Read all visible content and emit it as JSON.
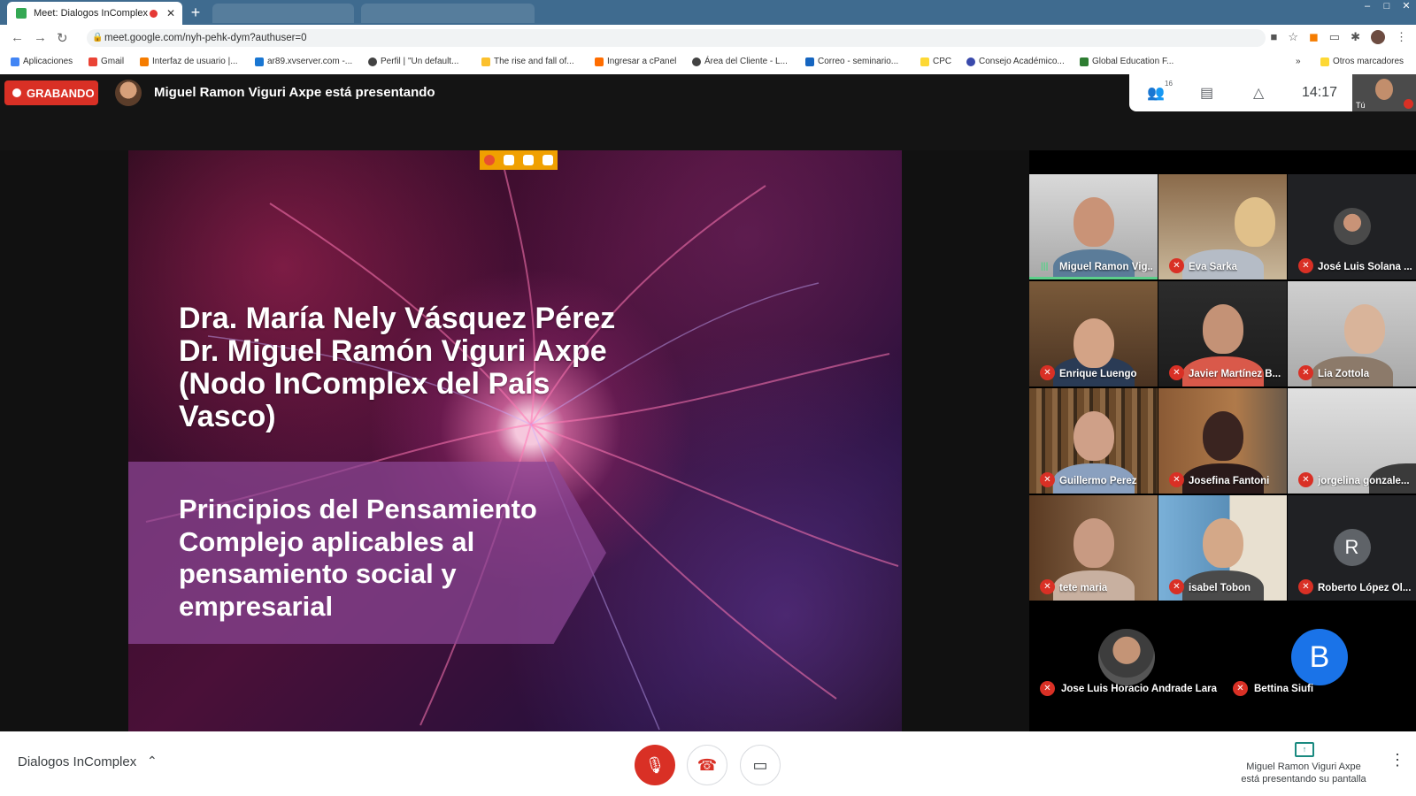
{
  "browser": {
    "tab_title": "Meet: Dialogos InComplex",
    "url": "meet.google.com/nyh-pehk-dym?authuser=0",
    "bookmarks": [
      {
        "label": "Aplicaciones",
        "color": "#4285f4"
      },
      {
        "label": "Gmail",
        "color": "#ea4335"
      },
      {
        "label": "Interfaz de usuario |...",
        "color": "#f57c00"
      },
      {
        "label": "ar89.xvserver.com -...",
        "color": "#1976d2"
      },
      {
        "label": "Perfil | \"Un default...",
        "color": "#424242"
      },
      {
        "label": "The rise and fall of...",
        "color": "#fbc02d"
      },
      {
        "label": "Ingresar a cPanel",
        "color": "#ff6d00"
      },
      {
        "label": "Área del Cliente - L...",
        "color": "#424242"
      },
      {
        "label": "Correo - seminario...",
        "color": "#1565c0"
      },
      {
        "label": "CPC",
        "color": "#fdd835"
      },
      {
        "label": "Consejo Académico...",
        "color": "#3949ab"
      },
      {
        "label": "Global Education F...",
        "color": "#2e7d32"
      }
    ],
    "other_bookmarks": "Otros marcadores",
    "overflow": "»"
  },
  "meet": {
    "recording_label": "GRABANDO",
    "presenting_banner": "Miguel Ramon Viguri Axpe está presentando",
    "participant_count": "16",
    "time": "14:17",
    "self_label": "Tú",
    "meeting_name": "Dialogos InComplex",
    "present_status_line1": "Miguel Ramon Viguri Axpe",
    "present_status_line2": "está presentando su pantalla"
  },
  "slide": {
    "title_lines": [
      "Dra. María Nely Vásquez Pérez",
      "Dr. Miguel Ramón Viguri Axpe",
      "(Nodo InComplex del País",
      "Vasco)"
    ],
    "subtitle_lines": [
      "Principios del Pensamiento",
      "Complejo aplicables al",
      "pensamiento social y",
      "empresarial"
    ]
  },
  "participants": [
    {
      "name": "Miguel Ramon Vig...",
      "muted": false,
      "speaking": true
    },
    {
      "name": "Eva Sarka",
      "muted": true
    },
    {
      "name": "José Luis Solana ...",
      "muted": true
    },
    {
      "name": "Enrique Luengo",
      "muted": true
    },
    {
      "name": "Javier Martínez B...",
      "muted": true
    },
    {
      "name": "Lia Zottola",
      "muted": true
    },
    {
      "name": "Guillermo Perez",
      "muted": true
    },
    {
      "name": "Josefina Fantoni",
      "muted": true
    },
    {
      "name": "jorgelina gonzale...",
      "muted": true
    },
    {
      "name": "tete maria",
      "muted": true
    },
    {
      "name": "isabel Tobon",
      "muted": true
    },
    {
      "name": "Roberto López Ol...",
      "muted": true,
      "initial": "R"
    },
    {
      "name": "Jose Luis Horacio Andrade Lara",
      "muted": true
    },
    {
      "name": "Bettina Siufi",
      "muted": true,
      "initial": "B"
    }
  ]
}
